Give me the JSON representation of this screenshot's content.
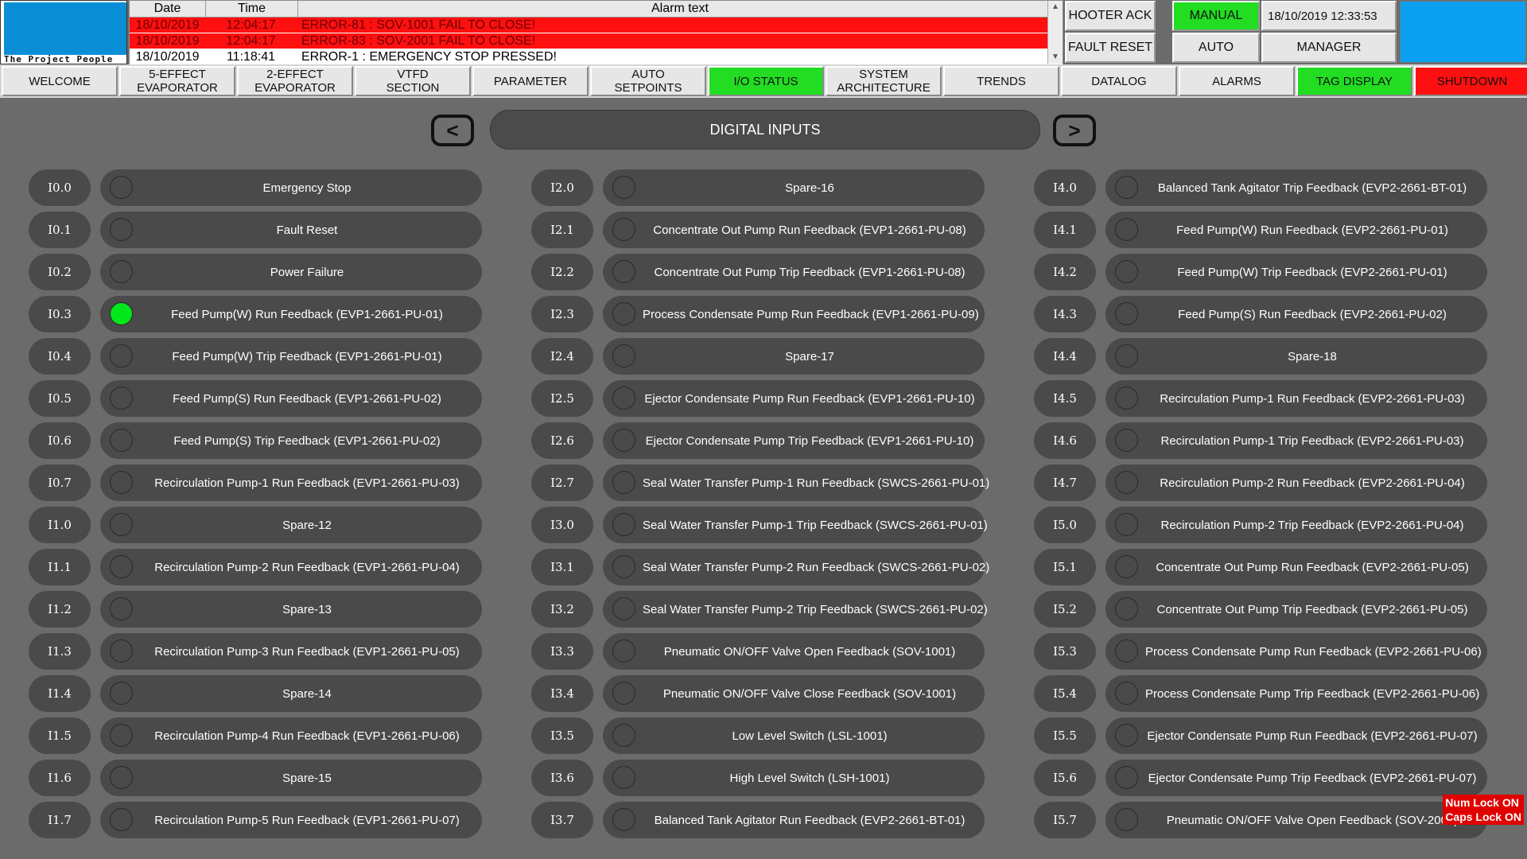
{
  "logo": {
    "text": "The Project People"
  },
  "alarm_table": {
    "headers": {
      "date": "Date",
      "time": "Time",
      "text": "Alarm text"
    },
    "rows": [
      {
        "date": "18/10/2019",
        "time": "12:04:17",
        "text": "ERROR-81 : SOV-1001 FAIL TO CLOSE!",
        "active": true
      },
      {
        "date": "18/10/2019",
        "time": "12:04:17",
        "text": "ERROR-83 : SOV-2001 FAIL TO CLOSE!",
        "active": true
      },
      {
        "date": "18/10/2019",
        "time": "11:18:41",
        "text": "ERROR-1 : EMERGENCY STOP PRESSED!",
        "active": false
      }
    ]
  },
  "header_buttons": {
    "hooter_ack": "HOOTER ACK",
    "manual": "MANUAL",
    "datetime": "18/10/2019 12:33:53",
    "fault_reset": "FAULT RESET",
    "auto": "AUTO",
    "manager": "MANAGER"
  },
  "colors": {
    "green": "#00e81a",
    "red": "#ff1010",
    "blue": "#0a9ff0",
    "panel": "#4a4a4a"
  },
  "tabs": [
    {
      "label": "WELCOME",
      "color": "#e6e6e6"
    },
    {
      "label": "5-EFFECT\nEVAPORATOR",
      "color": "#e6e6e6"
    },
    {
      "label": "2-EFFECT\nEVAPORATOR",
      "color": "#e6e6e6"
    },
    {
      "label": "VTFD\nSECTION",
      "color": "#e6e6e6"
    },
    {
      "label": "PARAMETER",
      "color": "#e6e6e6"
    },
    {
      "label": "AUTO\nSETPOINTS",
      "color": "#e6e6e6"
    },
    {
      "label": "I/O STATUS",
      "color": "#22dd22"
    },
    {
      "label": "SYSTEM\nARCHITECTURE",
      "color": "#e6e6e6"
    },
    {
      "label": "TRENDS",
      "color": "#e6e6e6"
    },
    {
      "label": "DATALOG",
      "color": "#e6e6e6"
    },
    {
      "label": "ALARMS",
      "color": "#e6e6e6"
    },
    {
      "label": "TAG DISPLAY",
      "color": "#22dd22"
    },
    {
      "label": "SHUTDOWN",
      "color": "#ff1010"
    }
  ],
  "page": {
    "title": "DIGITAL INPUTS",
    "prev_icon": "chevron-left-icon",
    "next_icon": "chevron-right-icon",
    "prev_glyph": "<",
    "next_glyph": ">"
  },
  "columns": [
    [
      {
        "tag": "I0.0",
        "desc": "Emergency Stop",
        "on": false
      },
      {
        "tag": "I0.1",
        "desc": "Fault Reset",
        "on": false
      },
      {
        "tag": "I0.2",
        "desc": "Power Failure",
        "on": false
      },
      {
        "tag": "I0.3",
        "desc": "Feed Pump(W) Run Feedback (EVP1-2661-PU-01)",
        "on": true
      },
      {
        "tag": "I0.4",
        "desc": "Feed Pump(W) Trip Feedback (EVP1-2661-PU-01)",
        "on": false
      },
      {
        "tag": "I0.5",
        "desc": "Feed Pump(S) Run Feedback (EVP1-2661-PU-02)",
        "on": false
      },
      {
        "tag": "I0.6",
        "desc": "Feed Pump(S) Trip Feedback (EVP1-2661-PU-02)",
        "on": false
      },
      {
        "tag": "I0.7",
        "desc": "Recirculation Pump-1 Run Feedback (EVP1-2661-PU-03)",
        "on": false
      },
      {
        "tag": "I1.0",
        "desc": "Spare-12",
        "on": false
      },
      {
        "tag": "I1.1",
        "desc": "Recirculation Pump-2 Run Feedback (EVP1-2661-PU-04)",
        "on": false
      },
      {
        "tag": "I1.2",
        "desc": "Spare-13",
        "on": false
      },
      {
        "tag": "I1.3",
        "desc": "Recirculation Pump-3 Run Feedback (EVP1-2661-PU-05)",
        "on": false
      },
      {
        "tag": "I1.4",
        "desc": "Spare-14",
        "on": false
      },
      {
        "tag": "I1.5",
        "desc": "Recirculation Pump-4 Run Feedback (EVP1-2661-PU-06)",
        "on": false
      },
      {
        "tag": "I1.6",
        "desc": "Spare-15",
        "on": false
      },
      {
        "tag": "I1.7",
        "desc": "Recirculation Pump-5 Run Feedback (EVP1-2661-PU-07)",
        "on": false
      }
    ],
    [
      {
        "tag": "I2.0",
        "desc": "Spare-16",
        "on": false
      },
      {
        "tag": "I2.1",
        "desc": "Concentrate Out Pump Run Feedback (EVP1-2661-PU-08)",
        "on": false
      },
      {
        "tag": "I2.2",
        "desc": "Concentrate Out Pump Trip Feedback (EVP1-2661-PU-08)",
        "on": false
      },
      {
        "tag": "I2.3",
        "desc": "Process Condensate Pump Run Feedback (EVP1-2661-PU-09)",
        "on": false
      },
      {
        "tag": "I2.4",
        "desc": "Spare-17",
        "on": false
      },
      {
        "tag": "I2.5",
        "desc": "Ejector Condensate Pump Run Feedback (EVP1-2661-PU-10)",
        "on": false
      },
      {
        "tag": "I2.6",
        "desc": "Ejector Condensate Pump Trip Feedback (EVP1-2661-PU-10)",
        "on": false
      },
      {
        "tag": "I2.7",
        "desc": "Seal Water Transfer Pump-1 Run Feedback (SWCS-2661-PU-01)",
        "on": false
      },
      {
        "tag": "I3.0",
        "desc": "Seal Water Transfer Pump-1 Trip Feedback (SWCS-2661-PU-01)",
        "on": false
      },
      {
        "tag": "I3.1",
        "desc": "Seal Water Transfer Pump-2 Run Feedback (SWCS-2661-PU-02)",
        "on": false
      },
      {
        "tag": "I3.2",
        "desc": "Seal Water Transfer Pump-2 Trip Feedback (SWCS-2661-PU-02)",
        "on": false
      },
      {
        "tag": "I3.3",
        "desc": "Pneumatic ON/OFF Valve Open Feedback (SOV-1001)",
        "on": false
      },
      {
        "tag": "I3.4",
        "desc": "Pneumatic ON/OFF Valve Close Feedback (SOV-1001)",
        "on": false
      },
      {
        "tag": "I3.5",
        "desc": "Low Level Switch (LSL-1001)",
        "on": false
      },
      {
        "tag": "I3.6",
        "desc": "High Level Switch (LSH-1001)",
        "on": false
      },
      {
        "tag": "I3.7",
        "desc": "Balanced Tank Agitator Run Feedback (EVP2-2661-BT-01)",
        "on": false
      }
    ],
    [
      {
        "tag": "I4.0",
        "desc": "Balanced Tank Agitator Trip Feedback (EVP2-2661-BT-01)",
        "on": false
      },
      {
        "tag": "I4.1",
        "desc": "Feed Pump(W) Run Feedback (EVP2-2661-PU-01)",
        "on": false
      },
      {
        "tag": "I4.2",
        "desc": "Feed Pump(W) Trip Feedback (EVP2-2661-PU-01)",
        "on": false
      },
      {
        "tag": "I4.3",
        "desc": "Feed Pump(S) Run Feedback (EVP2-2661-PU-02)",
        "on": false
      },
      {
        "tag": "I4.4",
        "desc": "Spare-18",
        "on": false
      },
      {
        "tag": "I4.5",
        "desc": "Recirculation Pump-1 Run Feedback (EVP2-2661-PU-03)",
        "on": false
      },
      {
        "tag": "I4.6",
        "desc": "Recirculation Pump-1 Trip Feedback (EVP2-2661-PU-03)",
        "on": false
      },
      {
        "tag": "I4.7",
        "desc": "Recirculation Pump-2 Run Feedback (EVP2-2661-PU-04)",
        "on": false
      },
      {
        "tag": "I5.0",
        "desc": "Recirculation Pump-2 Trip Feedback (EVP2-2661-PU-04)",
        "on": false
      },
      {
        "tag": "I5.1",
        "desc": "Concentrate Out Pump Run Feedback (EVP2-2661-PU-05)",
        "on": false
      },
      {
        "tag": "I5.2",
        "desc": "Concentrate Out Pump Trip Feedback (EVP2-2661-PU-05)",
        "on": false
      },
      {
        "tag": "I5.3",
        "desc": "Process Condensate Pump Run Feedback (EVP2-2661-PU-06)",
        "on": false
      },
      {
        "tag": "I5.4",
        "desc": "Process Condensate Pump Trip Feedback (EVP2-2661-PU-06)",
        "on": false
      },
      {
        "tag": "I5.5",
        "desc": "Ejector Condensate Pump Run Feedback (EVP2-2661-PU-07)",
        "on": false
      },
      {
        "tag": "I5.6",
        "desc": "Ejector Condensate Pump Trip Feedback (EVP2-2661-PU-07)",
        "on": false
      },
      {
        "tag": "I5.7",
        "desc": "Pneumatic ON/OFF Valve Open Feedback (SOV-2001)",
        "on": false
      }
    ]
  ],
  "status_indicator": {
    "num_lock": "Num Lock ON",
    "caps_lock": "Caps Lock ON"
  }
}
